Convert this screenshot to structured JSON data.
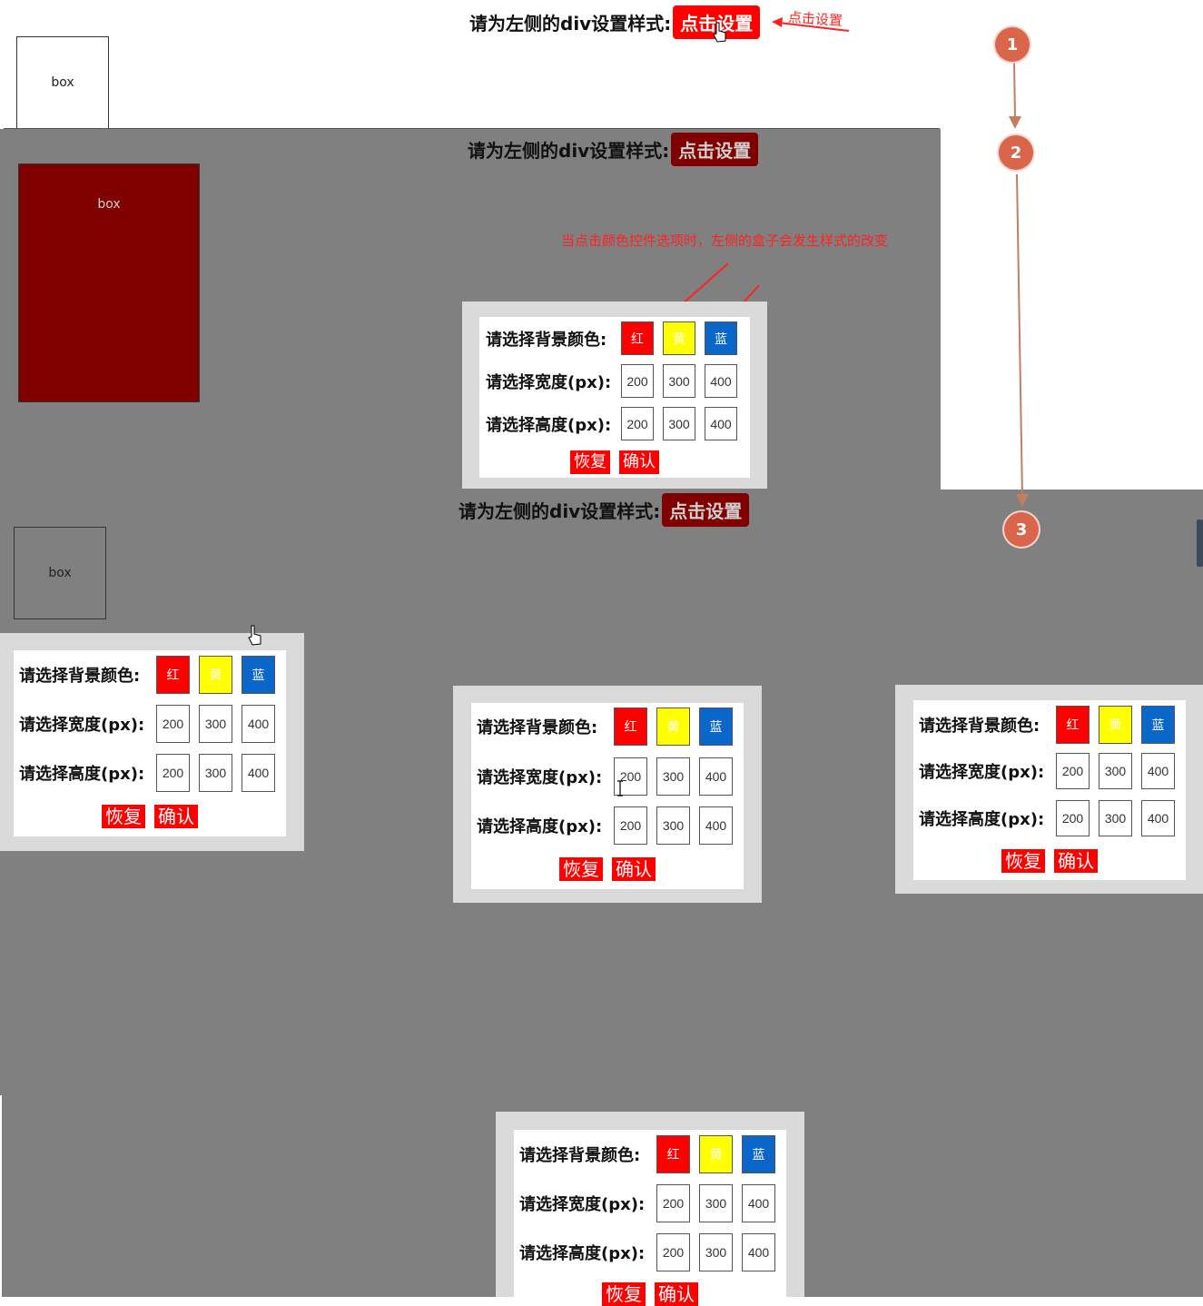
{
  "header": {
    "prompt": "请为左侧的div设置样式:",
    "button_label": "点击设置"
  },
  "box_label": "box",
  "annotations": {
    "click_hint": "点击设置",
    "color_hint": "当点击颜色控件选项时，左侧的盒子会发生样式的改变",
    "steps": [
      "1",
      "2",
      "3"
    ]
  },
  "panel": {
    "bg_label": "请选择背景颜色:",
    "width_label": "请选择宽度(px):",
    "height_label": "请选择高度(px):",
    "colors": [
      {
        "label": "红",
        "color": "#ff0000"
      },
      {
        "label": "黄",
        "color": "#ffff00"
      },
      {
        "label": "蓝",
        "color": "#0a66c9"
      }
    ],
    "sizes": [
      "200",
      "300",
      "400"
    ],
    "reset_label": "恢复",
    "confirm_label": "确认"
  },
  "state_2": {
    "box_bg": "#800000"
  },
  "colors": {
    "overlay": "#808080",
    "accent": "#ff0000",
    "step_badge": "#d9654a"
  }
}
